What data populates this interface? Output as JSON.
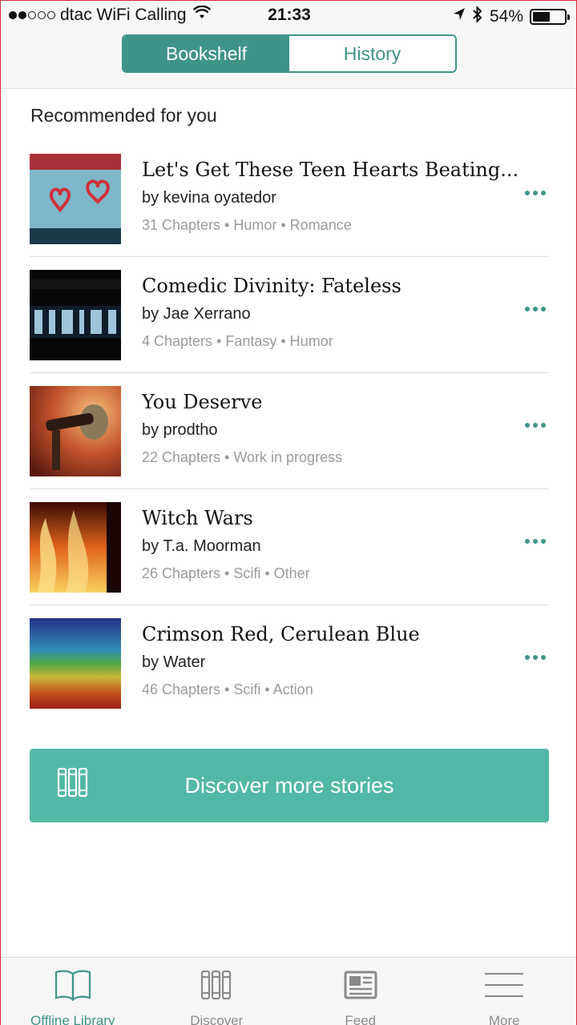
{
  "status_bar": {
    "carrier": "dtac WiFi Calling",
    "time": "21:33",
    "battery": "54%",
    "battery_level": 0.54
  },
  "segments": {
    "bookshelf": "Bookshelf",
    "history": "History",
    "active": "bookshelf"
  },
  "section_title": "Recommended for you",
  "stories": [
    {
      "title": "Let's Get These Teen Hearts Beating...",
      "author": "by kevina oyatedor",
      "meta": "31 Chapters • Humor • Romance"
    },
    {
      "title": "Comedic Divinity: Fateless",
      "author": "by Jae Xerrano",
      "meta": "4 Chapters • Fantasy • Humor"
    },
    {
      "title": "You Deserve",
      "author": "by prodtho",
      "meta": "22 Chapters • Work in progress"
    },
    {
      "title": "Witch Wars",
      "author": "by T.a. Moorman",
      "meta": "26 Chapters • Scifi • Other"
    },
    {
      "title": "Crimson Red, Cerulean Blue",
      "author": "by Water",
      "meta": "46 Chapters • Scifi • Action"
    }
  ],
  "discover_button": "Discover more stories",
  "tabs": [
    {
      "label": "Offline Library",
      "icon": "book-open-icon"
    },
    {
      "label": "Discover",
      "icon": "books-icon"
    },
    {
      "label": "Feed",
      "icon": "newspaper-icon"
    },
    {
      "label": "More",
      "icon": "menu-icon"
    }
  ],
  "colors": {
    "accent": "#3f9488",
    "button": "#52b8a5"
  }
}
